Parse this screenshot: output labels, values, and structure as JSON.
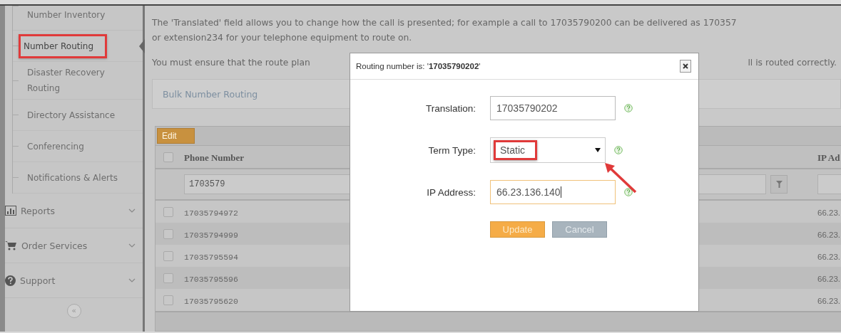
{
  "sidebar": {
    "submenu": [
      {
        "label": "Number Inventory",
        "selected": false,
        "highlighted": false
      },
      {
        "label": "Number Routing",
        "selected": true,
        "highlighted": true
      },
      {
        "label": "Disaster Recovery Routing",
        "selected": false,
        "highlighted": false
      },
      {
        "label": "Directory Assistance",
        "selected": false,
        "highlighted": false
      },
      {
        "label": "Conferencing",
        "selected": false,
        "highlighted": false
      },
      {
        "label": "Notifications & Alerts",
        "selected": false,
        "highlighted": false
      }
    ],
    "sections": [
      {
        "label": "Reports",
        "kind": "chart",
        "expanded": false
      },
      {
        "label": "Order Services",
        "kind": "cart",
        "expanded": false
      },
      {
        "label": "Support",
        "kind": "help",
        "expanded": false
      }
    ],
    "collapse": "«"
  },
  "intro": {
    "lines": [
      "The 'Translated' field allows you to change how the call is presented; for example a call to 17035790200 can be delivered as 170357",
      "or extension234 for your telephone equipment to route on."
    ],
    "note_fragments": [
      "You must ensure that the route plan",
      "ll is routed correctly."
    ]
  },
  "bulk_link": "Bulk Number Routing",
  "table": {
    "toolbar_button": "Edit",
    "columns": [
      "Phone Number",
      "IP Ad"
    ],
    "select_all_checked": false,
    "filter": {
      "value": "1703579"
    },
    "rows": [
      {
        "checked": false,
        "phone": "17035794972",
        "ip": "66.23."
      },
      {
        "checked": false,
        "phone": "17035794999",
        "ip": "66.23."
      },
      {
        "checked": false,
        "phone": "17035795594",
        "ip": "66.23."
      },
      {
        "checked": false,
        "phone": "17035795596",
        "ip": "66.23."
      },
      {
        "checked": false,
        "phone": "17035795620",
        "ip": "66.23."
      }
    ]
  },
  "modal": {
    "title": "Routing number is: '**17035790202**'",
    "fields": [
      {
        "kind": "text",
        "label": "Translation:",
        "value": "17035790202",
        "focused": false,
        "highlighted": false
      },
      {
        "kind": "select",
        "label": "Term Type:",
        "value": "Static",
        "focused": false,
        "highlighted": true
      },
      {
        "kind": "text",
        "label": "IP Address:",
        "value": "66.23.136.140",
        "focused": true,
        "highlighted": false
      }
    ],
    "pointer_arrow": true,
    "buttons": [
      {
        "label": "Update",
        "kind": "primary"
      },
      {
        "label": "Cancel",
        "kind": "secondary"
      }
    ]
  }
}
